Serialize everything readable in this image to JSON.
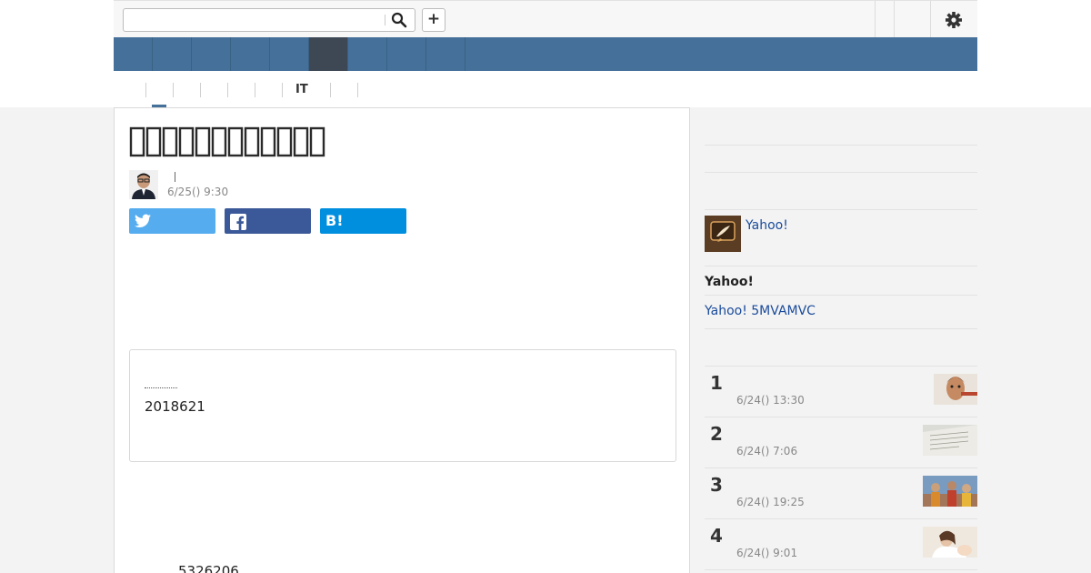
{
  "header": {
    "search": {
      "value": "",
      "placeholder": ""
    },
    "search_icon": "search-icon",
    "add_button_label": "+",
    "settings_icon": "gear-icon"
  },
  "nav": {
    "items": [
      "",
      "",
      "",
      "",
      "",
      "",
      "",
      "",
      ""
    ],
    "active_index": 5
  },
  "subnav": {
    "items": [
      "",
      "",
      "",
      "",
      "",
      "IT",
      ""
    ],
    "active_index": 0
  },
  "article": {
    "title": "",
    "author": "",
    "date": "6/25() 9:30",
    "share": {
      "twitter_label": "",
      "facebook_label": "",
      "hatena_label": "B!"
    },
    "summary_label": "",
    "summary_number": "2018621",
    "body_number": "5326206"
  },
  "sidebar": {
    "yahoo_link": "Yahoo!",
    "heading": "Yahoo!",
    "link": "Yahoo! 5MVAMVC",
    "ranking": [
      {
        "rank": "1",
        "date": "6/24() 13:30"
      },
      {
        "rank": "2",
        "date": "6/24() 7:06"
      },
      {
        "rank": "3",
        "date": "6/24() 19:25"
      },
      {
        "rank": "4",
        "date": "6/24() 9:01"
      }
    ]
  },
  "colors": {
    "nav_bg": "#45709a",
    "nav_active": "#3d4854",
    "link": "#1a4b9b",
    "twitter": "#55acee",
    "facebook": "#3b5998",
    "hatena": "#008fde"
  }
}
